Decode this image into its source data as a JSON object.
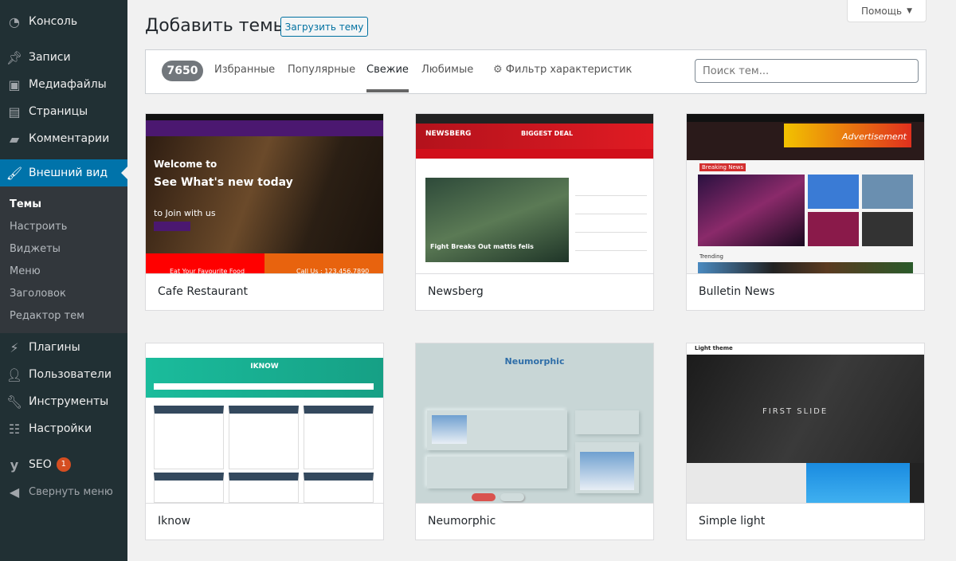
{
  "sidebar": {
    "items": [
      {
        "label": "Консоль",
        "icon": "dashboard-icon"
      },
      {
        "label": "Записи",
        "icon": "pin-icon"
      },
      {
        "label": "Медиафайлы",
        "icon": "media-icon"
      },
      {
        "label": "Страницы",
        "icon": "page-icon"
      },
      {
        "label": "Комментарии",
        "icon": "comment-icon"
      },
      {
        "label": "Внешний вид",
        "icon": "brush-icon",
        "active": true
      },
      {
        "label": "Плагины",
        "icon": "plugin-icon"
      },
      {
        "label": "Пользователи",
        "icon": "user-icon"
      },
      {
        "label": "Инструменты",
        "icon": "wrench-icon"
      },
      {
        "label": "Настройки",
        "icon": "settings-icon"
      },
      {
        "label": "SEO",
        "icon": "yoast-icon",
        "badge": "1"
      },
      {
        "label": "Свернуть меню",
        "icon": "collapse-icon"
      }
    ],
    "submenu": [
      "Темы",
      "Настроить",
      "Виджеты",
      "Меню",
      "Заголовок",
      "Редактор тем"
    ]
  },
  "header": {
    "title": "Добавить темы",
    "upload_label": "Загрузить тему",
    "help_label": "Помощь"
  },
  "filter": {
    "count": "7650",
    "tabs": [
      "Избранные",
      "Популярные",
      "Свежие",
      "Любимые"
    ],
    "active_tab": "Свежие",
    "feature_filter": "Фильтр характеристик",
    "search_placeholder": "Поиск тем..."
  },
  "themes": [
    {
      "name": "Cafe Restaurant",
      "shot": {
        "l1": "Welcome to",
        "l2": "See What's new today",
        "l3": "to Join with us",
        "footer": "Eat Your Favourite Food",
        "phone": "Call Us : 123.456.7890"
      }
    },
    {
      "name": "Newsberg",
      "shot": {
        "brand": "NEWSBERG",
        "deal": "BIGGEST DEAL",
        "caption": "Fight Breaks Out mattis felis"
      }
    },
    {
      "name": "Bulletin News",
      "shot": {
        "ad": "Advertisement",
        "breaking": "Breaking News",
        "trending": "Trending"
      }
    },
    {
      "name": "Iknow",
      "shot": {
        "brand": "IKNOW"
      }
    },
    {
      "name": "Neumorphic",
      "shot": {
        "brand": "Neumorphic"
      }
    },
    {
      "name": "Simple light",
      "shot": {
        "brand": "Light theme",
        "slide": "FIRST SLIDE"
      }
    }
  ],
  "colors": {
    "sidebar": "#213034",
    "active": "#0073aa",
    "submenu": "#32373c",
    "badge": "#d54e21"
  }
}
